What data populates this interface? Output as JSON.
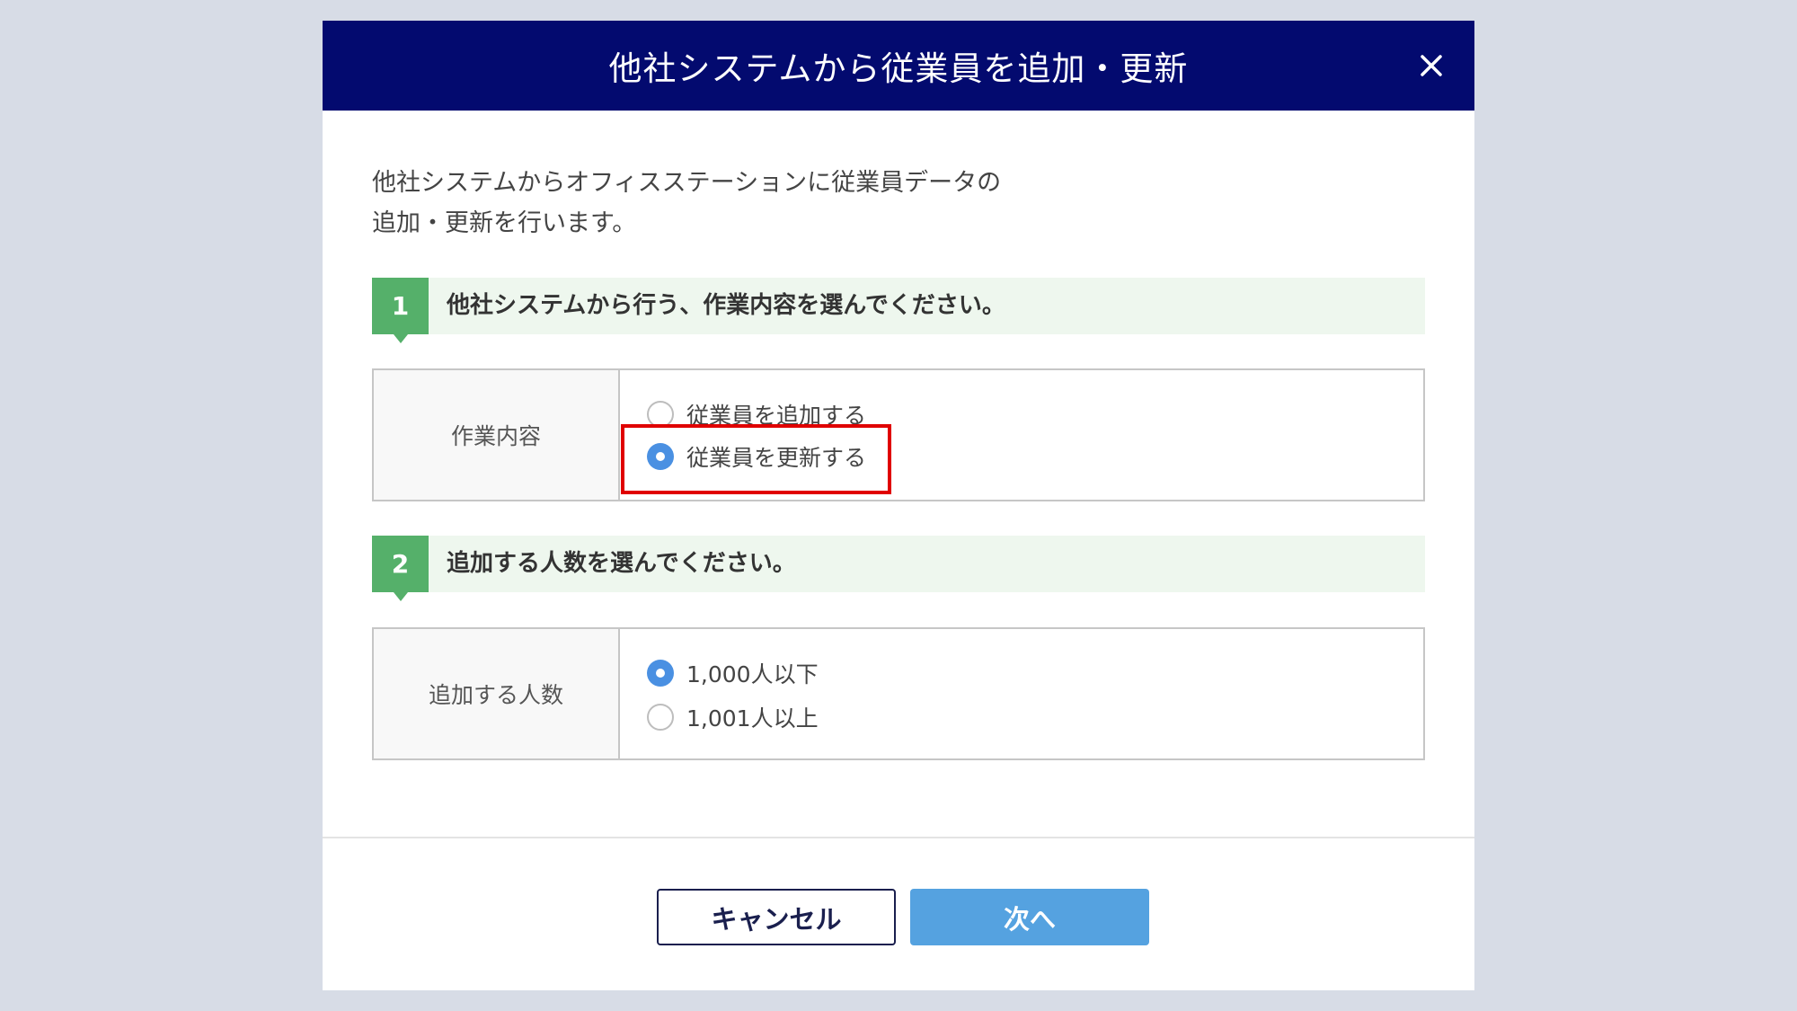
{
  "modal": {
    "title": "他社システムから従業員を追加・更新",
    "close_icon": "close-icon",
    "intro_lines": [
      "他社システムからオフィスステーションに従業員データの",
      "追加・更新を行います。"
    ]
  },
  "step1": {
    "number": "1",
    "label": "他社システムから行う、作業内容を選んでください。",
    "field_label": "作業内容",
    "options": [
      {
        "label": "従業員を追加する",
        "checked": false
      },
      {
        "label": "従業員を更新する",
        "checked": true
      }
    ]
  },
  "step2": {
    "number": "2",
    "label": "追加する人数を選んでください。",
    "field_label": "追加する人数",
    "options": [
      {
        "label": "1,000人以下",
        "checked": true
      },
      {
        "label": "1,001人以上",
        "checked": false
      }
    ]
  },
  "footer": {
    "cancel_label": "キャンセル",
    "next_label": "次へ"
  },
  "colors": {
    "header_bg": "#030a6f",
    "step_badge": "#55b06a",
    "radio_checked": "#4a90e2",
    "highlight": "#e00000",
    "next_button": "#55a2e0"
  }
}
